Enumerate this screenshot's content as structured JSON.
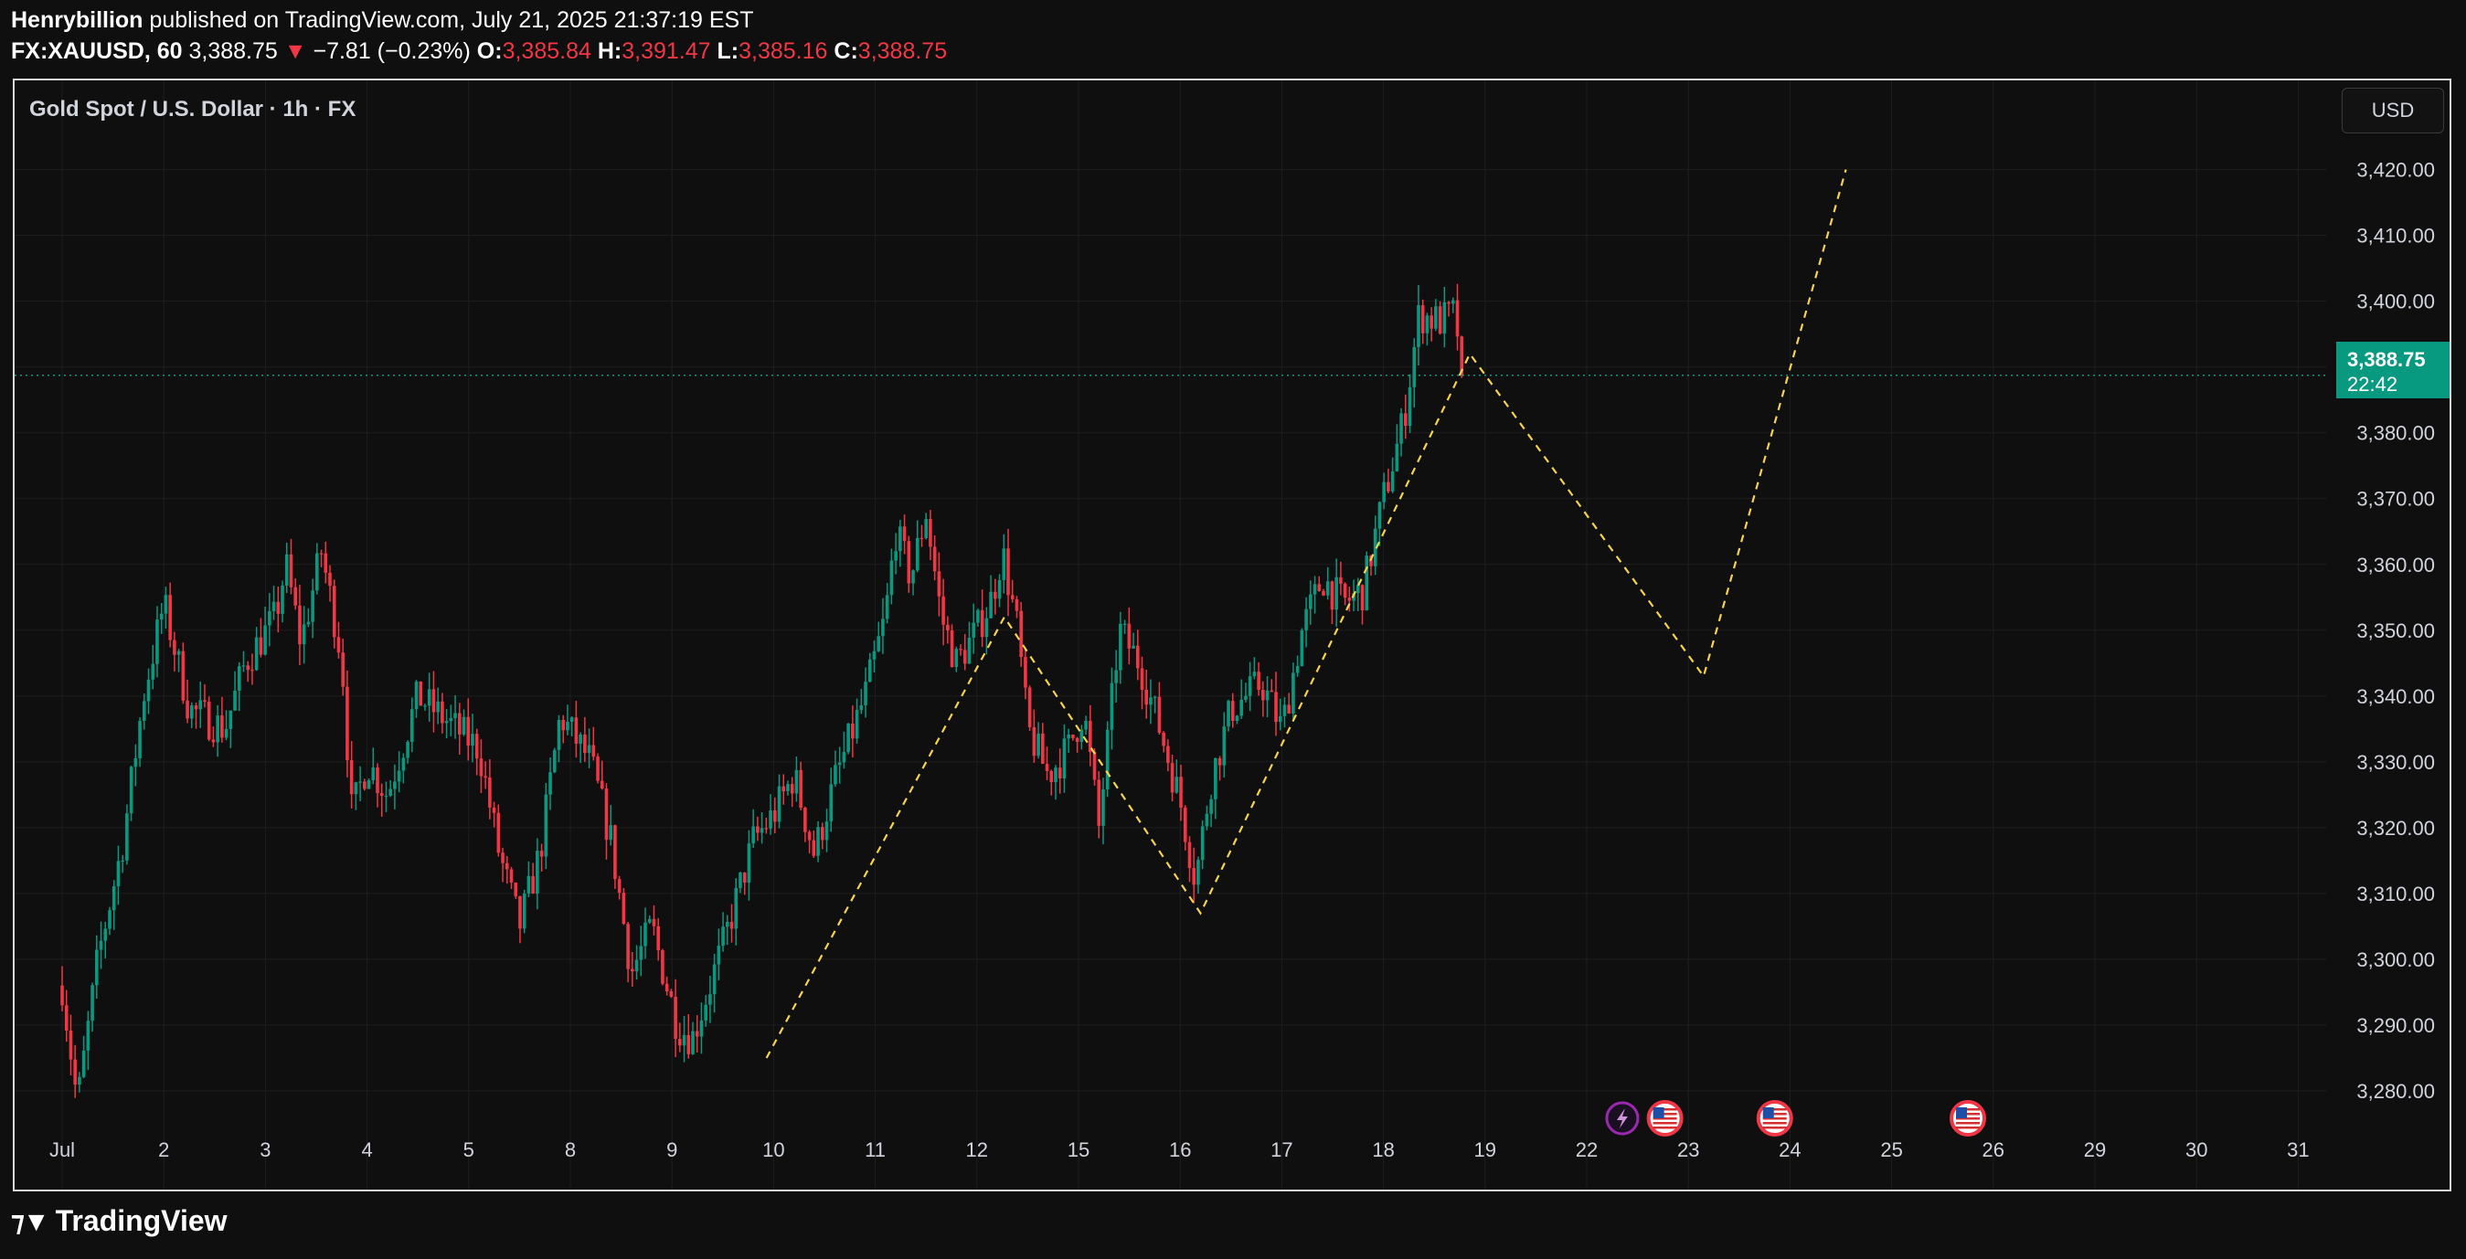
{
  "header": {
    "author": "Henrybillion",
    "published": "published on TradingView.com, July 21, 2025 21:37:19 EST",
    "symbol": "FX:XAUUSD, 60",
    "last": "3,388.75",
    "change_arrow": "▼",
    "change": "−7.81 (−0.23%)",
    "o_label": "O:",
    "o_value": "3,385.84",
    "h_label": "H:",
    "h_value": "3,391.47",
    "l_label": "L:",
    "l_value": "3,385.16",
    "c_label": "C:",
    "c_value": "3,388.75"
  },
  "chart_title": "Gold Spot / U.S. Dollar · 1h · FX",
  "currency_button": "USD",
  "price_tag": {
    "price": "3,388.75",
    "countdown": "22:42"
  },
  "brand": {
    "logo_icon": "tradingview-logo-icon",
    "name": "TradingView"
  },
  "event_icons": [
    "lightning-icon",
    "us-flag-icon",
    "us-flag-icon",
    "us-flag-icon"
  ],
  "colors": {
    "up": "#089981",
    "down": "#f23645",
    "projection": "#f5d547",
    "background": "#0f0f0f",
    "grid": "#1e1e1e"
  },
  "chart_data": {
    "type": "candlestick",
    "title": "Gold Spot / U.S. Dollar · 1h · FX",
    "ylim": [
      3275,
      3423
    ],
    "y_ticks": [
      "3,280.00",
      "3,290.00",
      "3,300.00",
      "3,310.00",
      "3,320.00",
      "3,330.00",
      "3,340.00",
      "3,350.00",
      "3,360.00",
      "3,370.00",
      "3,380.00",
      "3,390.00",
      "3,400.00",
      "3,410.00",
      "3,420.00"
    ],
    "x_ticks": [
      "Jul",
      "2",
      "3",
      "4",
      "5",
      "8",
      "9",
      "10",
      "11",
      "12",
      "15",
      "16",
      "17",
      "18",
      "19",
      "22",
      "23",
      "24",
      "25",
      "26",
      "29",
      "30",
      "31"
    ],
    "last_price": 3388.75,
    "price_path": [
      [
        0.0,
        3296
      ],
      [
        0.15,
        3278
      ],
      [
        0.35,
        3300
      ],
      [
        0.6,
        3318
      ],
      [
        0.8,
        3340
      ],
      [
        1.0,
        3354
      ],
      [
        1.25,
        3338
      ],
      [
        1.6,
        3335
      ],
      [
        1.8,
        3345
      ],
      [
        2.1,
        3352
      ],
      [
        2.2,
        3360
      ],
      [
        2.35,
        3348
      ],
      [
        2.55,
        3362
      ],
      [
        2.75,
        3346
      ],
      [
        2.85,
        3322
      ],
      [
        3.0,
        3330
      ],
      [
        3.2,
        3325
      ],
      [
        3.5,
        3340
      ],
      [
        3.8,
        3336
      ],
      [
        4.1,
        3332
      ],
      [
        4.3,
        3316
      ],
      [
        4.5,
        3305
      ],
      [
        4.7,
        3316
      ],
      [
        4.9,
        3337
      ],
      [
        5.2,
        3330
      ],
      [
        5.4,
        3318
      ],
      [
        5.6,
        3298
      ],
      [
        5.8,
        3305
      ],
      [
        6.05,
        3290
      ],
      [
        6.2,
        3288
      ],
      [
        6.5,
        3302
      ],
      [
        6.8,
        3318
      ],
      [
        7.0,
        3322
      ],
      [
        7.2,
        3328
      ],
      [
        7.4,
        3316
      ],
      [
        7.6,
        3327
      ],
      [
        7.9,
        3340
      ],
      [
        8.1,
        3352
      ],
      [
        8.2,
        3365
      ],
      [
        8.35,
        3358
      ],
      [
        8.5,
        3368
      ],
      [
        8.65,
        3352
      ],
      [
        8.8,
        3345
      ],
      [
        9.0,
        3350
      ],
      [
        9.15,
        3355
      ],
      [
        9.25,
        3362
      ],
      [
        9.4,
        3350
      ],
      [
        9.5,
        3335
      ],
      [
        9.7,
        3328
      ],
      [
        9.9,
        3332
      ],
      [
        10.05,
        3338
      ],
      [
        10.2,
        3320
      ],
      [
        10.3,
        3335
      ],
      [
        10.4,
        3350
      ],
      [
        10.6,
        3345
      ],
      [
        10.8,
        3335
      ],
      [
        11.0,
        3324
      ],
      [
        11.15,
        3312
      ],
      [
        11.3,
        3327
      ],
      [
        11.5,
        3338
      ],
      [
        11.8,
        3342
      ],
      [
        12.0,
        3335
      ],
      [
        12.2,
        3350
      ],
      [
        12.4,
        3358
      ],
      [
        12.6,
        3354
      ],
      [
        12.8,
        3356
      ],
      [
        13.0,
        3370
      ],
      [
        13.2,
        3382
      ],
      [
        13.35,
        3398
      ],
      [
        13.55,
        3397
      ],
      [
        13.7,
        3398
      ],
      [
        13.8,
        3388.75
      ]
    ],
    "projection": [
      [
        6.93,
        3285
      ],
      [
        9.27,
        3352
      ],
      [
        11.2,
        3307
      ],
      [
        13.85,
        3392
      ],
      [
        16.15,
        3343
      ],
      [
        17.55,
        3420
      ]
    ],
    "event_markers": [
      {
        "type": "lightning",
        "x": 15.35
      },
      {
        "type": "us-flag",
        "x": 15.77
      },
      {
        "type": "us-flag",
        "x": 16.85
      },
      {
        "type": "us-flag",
        "x": 18.75
      }
    ]
  }
}
